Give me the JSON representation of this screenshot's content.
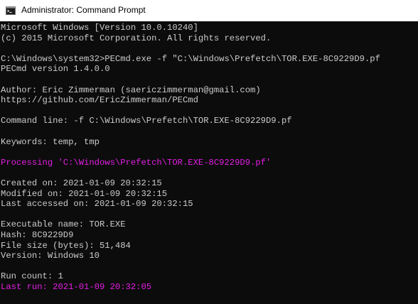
{
  "window": {
    "title": "Administrator: Command Prompt",
    "icon": "cmd-icon"
  },
  "colors": {
    "background": "#0c0c0c",
    "text": "#cccccc",
    "highlight": "#e51ee5"
  },
  "console": {
    "lines": [
      {
        "text": "Microsoft Windows [Version 10.0.10240]",
        "color": "default"
      },
      {
        "text": "(c) 2015 Microsoft Corporation. All rights reserved.",
        "color": "default"
      },
      {
        "text": "",
        "color": "default"
      },
      {
        "text": "C:\\Windows\\system32>PECmd.exe -f \"C:\\Windows\\Prefetch\\TOR.EXE-8C9229D9.pf",
        "color": "default"
      },
      {
        "text": "PECmd version 1.4.0.0",
        "color": "default"
      },
      {
        "text": "",
        "color": "default"
      },
      {
        "text": "Author: Eric Zimmerman (saericzimmerman@gmail.com)",
        "color": "default"
      },
      {
        "text": "https://github.com/EricZimmerman/PECmd",
        "color": "default"
      },
      {
        "text": "",
        "color": "default"
      },
      {
        "text": "Command line: -f C:\\Windows\\Prefetch\\TOR.EXE-8C9229D9.pf",
        "color": "default"
      },
      {
        "text": "",
        "color": "default"
      },
      {
        "text": "Keywords: temp, tmp",
        "color": "default"
      },
      {
        "text": "",
        "color": "default"
      },
      {
        "text": "Processing 'C:\\Windows\\Prefetch\\TOR.EXE-8C9229D9.pf'",
        "color": "magenta"
      },
      {
        "text": "",
        "color": "default"
      },
      {
        "text": "Created on: 2021-01-09 20:32:15",
        "color": "default"
      },
      {
        "text": "Modified on: 2021-01-09 20:32:15",
        "color": "default"
      },
      {
        "text": "Last accessed on: 2021-01-09 20:32:15",
        "color": "default"
      },
      {
        "text": "",
        "color": "default"
      },
      {
        "text": "Executable name: TOR.EXE",
        "color": "default"
      },
      {
        "text": "Hash: 8C9229D9",
        "color": "default"
      },
      {
        "text": "File size (bytes): 51,484",
        "color": "default"
      },
      {
        "text": "Version: Windows 10",
        "color": "default"
      },
      {
        "text": "",
        "color": "default"
      },
      {
        "text": "Run count: 1",
        "color": "default"
      },
      {
        "text": "Last run: 2021-01-09 20:32:05",
        "color": "magenta"
      }
    ]
  }
}
